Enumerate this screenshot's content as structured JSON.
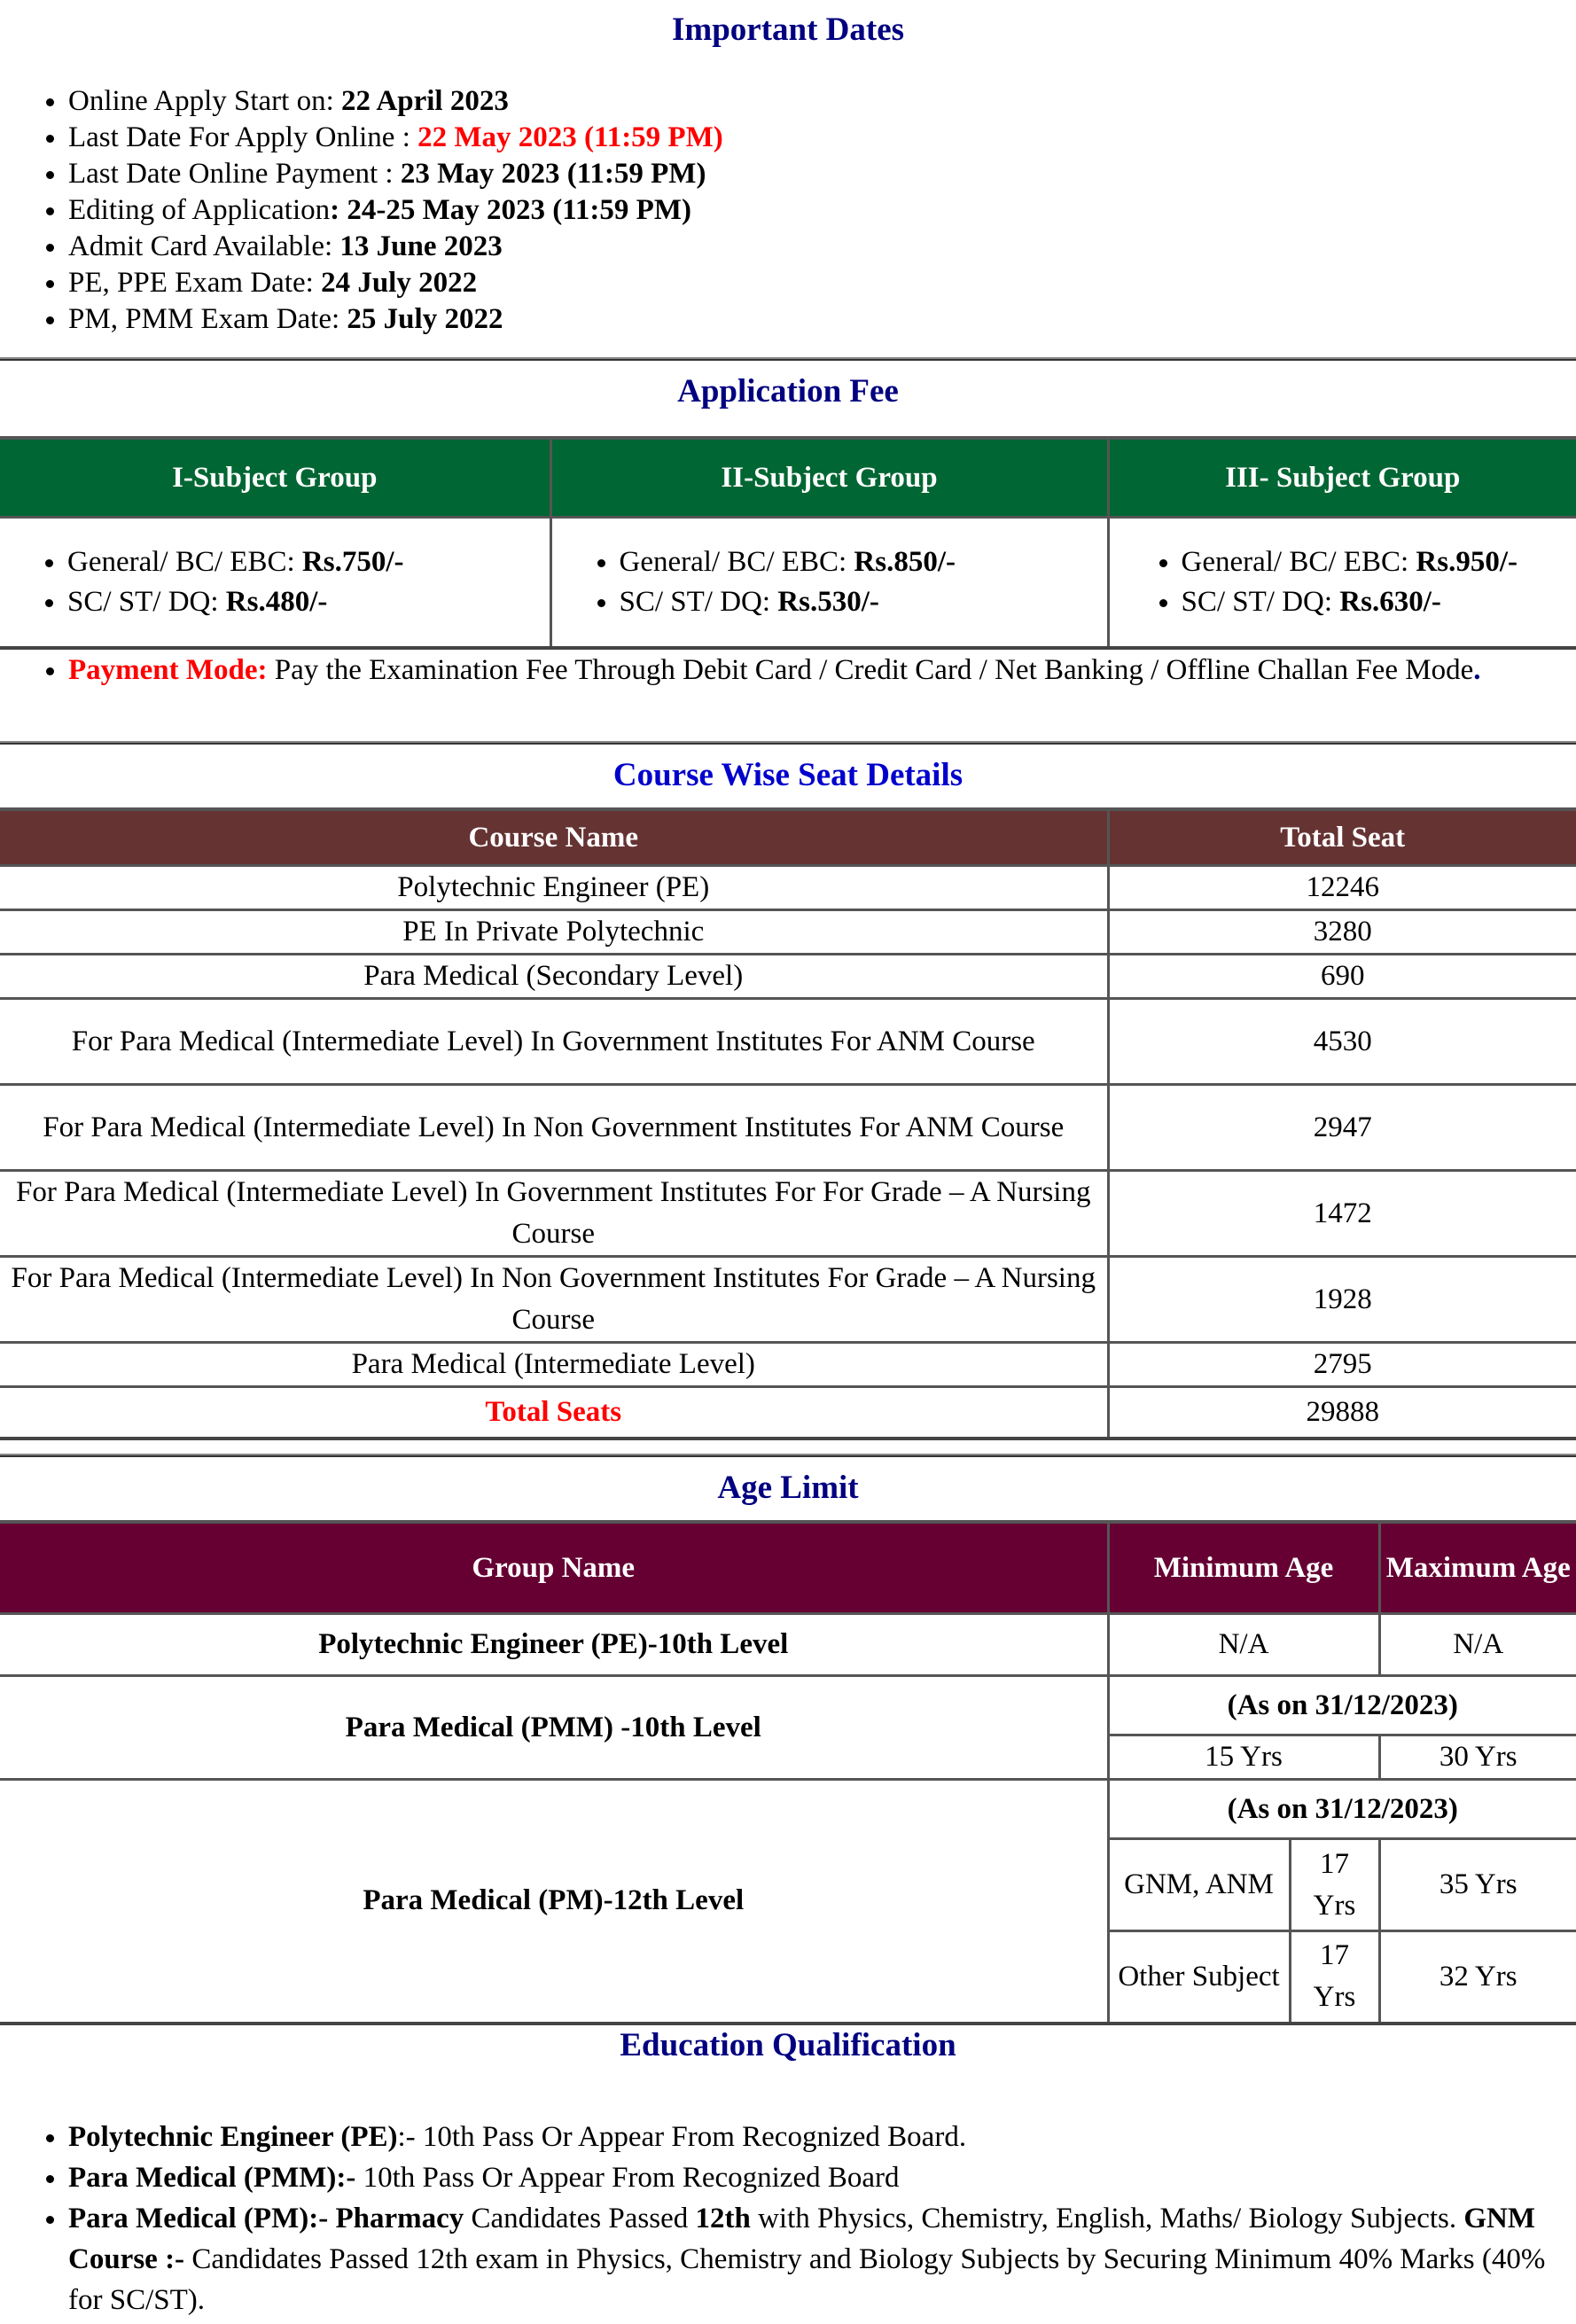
{
  "important_dates": {
    "title": "Important Dates",
    "items": [
      {
        "label": "Online Apply Start on: ",
        "value": "22 April 2023"
      },
      {
        "label": "Last Date For Apply Online : ",
        "value": "22 May 2023 (11:59 PM)"
      },
      {
        "label": "Last Date Online Payment : ",
        "value": "23 May 2023 (11:59 PM)"
      },
      {
        "label": "Editing of Application",
        "value": ": 24-25 May 2023 (11:59 PM)"
      },
      {
        "label": "Admit Card Available:  ",
        "value": "13 June 2023"
      },
      {
        "label": "PE, PPE Exam Date: ",
        "value": "24 July 2022"
      },
      {
        "label": "PM, PMM Exam Date:  ",
        "value": "25 July 2022"
      }
    ]
  },
  "application_fee": {
    "title": "Application Fee",
    "header_color": "#006633",
    "columns": [
      "I-Subject Group",
      "II-Subject Group",
      "III- Subject Group"
    ],
    "groups": [
      [
        {
          "label": "General/ BC/ EBC: ",
          "value": "Rs.750/-"
        },
        {
          "label": "SC/ ST/ DQ: ",
          "value": "Rs.480/-"
        }
      ],
      [
        {
          "label": "General/ BC/ EBC: ",
          "value": "Rs.850/-"
        },
        {
          "label": "SC/ ST/ DQ: ",
          "value": "Rs.530/-"
        }
      ],
      [
        {
          "label": "General/ BC/ EBC: ",
          "value": "Rs.950/-"
        },
        {
          "label": "SC/ ST/ DQ: ",
          "value": "Rs.630/-"
        }
      ]
    ],
    "payment_mode": {
      "label": "Payment Mode:",
      "text": " Pay the Examination Fee Through Debit Card / Credit Card / Net Banking  / Offline Challan Fee Mode",
      "end": "."
    }
  },
  "course_seats": {
    "title": "Course Wise Seat Details",
    "header_color": "#663333",
    "columns": [
      "Course Name",
      "Total Seat"
    ],
    "rows": [
      {
        "course": "Polytechnic Engineer (PE)",
        "seats": "12246"
      },
      {
        "course": "PE In Private Polytechnic",
        "seats": "3280"
      },
      {
        "course": "Para Medical (Secondary Level)",
        "seats": "690"
      },
      {
        "course": "For Para Medical (Intermediate Level) In Government Institutes For ANM Course",
        "seats": "4530"
      },
      {
        "course": "For Para Medical (Intermediate Level) In Non Government Institutes For ANM Course",
        "seats": "2947"
      },
      {
        "course": "For Para Medical (Intermediate Level) In Government Institutes For For Grade – A Nursing Course",
        "seats": "1472"
      },
      {
        "course": "For Para Medical (Intermediate Level) In Non Government Institutes For Grade – A Nursing Course",
        "seats": "1928"
      },
      {
        "course": "Para Medical (Intermediate Level)",
        "seats": "2795"
      }
    ],
    "total": {
      "label": "Total Seats",
      "value": "29888"
    }
  },
  "age_limit": {
    "title": "Age Limit",
    "header_color": "#660033",
    "columns": [
      "Group Name",
      "Minimum Age",
      "Maximum Age"
    ],
    "pe": {
      "group": "Polytechnic Engineer (PE)-10th Level",
      "min": "N/A",
      "max": "N/A"
    },
    "pmm": {
      "group": "Para Medical (PMM) -10th Level",
      "as_on": "(As on 31/12/2023)",
      "min": "15 Yrs",
      "max": "30 Yrs"
    },
    "pm": {
      "group": "Para Medical (PM)-12th Level",
      "as_on": "(As on 31/12/2023)",
      "sub": [
        {
          "subject": "GNM, ANM",
          "min": "17 Yrs",
          "max": "35 Yrs"
        },
        {
          "subject": "Other Subject",
          "min": "17 Yrs",
          "max": "32 Yrs"
        }
      ]
    }
  },
  "education": {
    "title": "Education Qualification",
    "items": [
      {
        "bold": "Polytechnic Engineer (PE)",
        "text": ":- 10th Pass Or Appear From Recognized Board."
      },
      {
        "bold": "Para Medical (PMM):-",
        "text": " 10th Pass Or Appear From Recognized Board"
      }
    ],
    "pm": {
      "bold1": "Para Medical (PM):- Pharmacy",
      "text1": "  Candidates Passed ",
      "bold2": "12th",
      "text2": " with Physics, Chemistry, English, Maths/ Biology Subjects. ",
      "bold3": "GNM Course :-",
      "text3": " Candidates Passed 12th exam in Physics, Chemistry and Biology Subjects by Securing Minimum 40% Marks (40% for SC/ST)."
    }
  }
}
